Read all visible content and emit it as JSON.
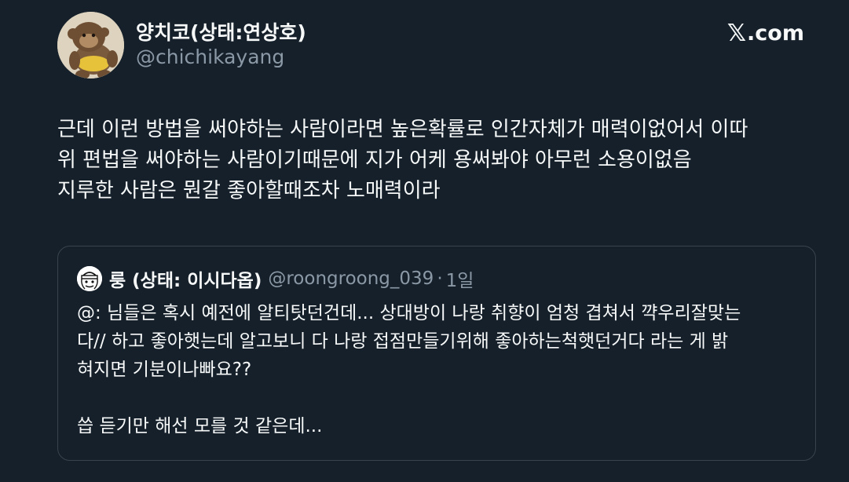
{
  "author": {
    "name": "양치코(상태:연상호)",
    "handle": "@chichikayang",
    "avatar_icon": "plush-toy-avatar"
  },
  "brand": {
    "x_glyph": "𝕏",
    "label": ".com"
  },
  "post": {
    "lines": [
      "근데 이런 방법을 써야하는 사람이라면 높은확률로 인간자체가 매력이없어서 이따",
      "위 편법을 써야하는 사람이기때문에 지가 어케 용써봐야 아무런 소용이없음",
      "지루한 사람은 뭔갈 좋아할때조차 노매력이라"
    ]
  },
  "quote": {
    "name": "룽 (상태: 이시다옵)",
    "handle": "@roongroong_039",
    "separator": "·",
    "time": "1일",
    "avatar_icon": "cartoon-face-avatar",
    "lines": [
      "@: 님들은 혹시 예전에 알티탓던건데... 상대방이 나랑  취향이 엄청 겹쳐서 꺅우리잘맞는",
      "다// 하고 좋아햇는데 알고보니 다 나랑 접점만들기위해 좋아하는척햇던거다 라는 게 밝",
      "혀지면 기분이나빠요??",
      "",
      "씁 듣기만 해선 모를 것 같은데..."
    ]
  },
  "colors": {
    "background": "#15202b",
    "text": "#f7f9f9",
    "secondary": "#8b98a5",
    "border": "#38444d"
  }
}
